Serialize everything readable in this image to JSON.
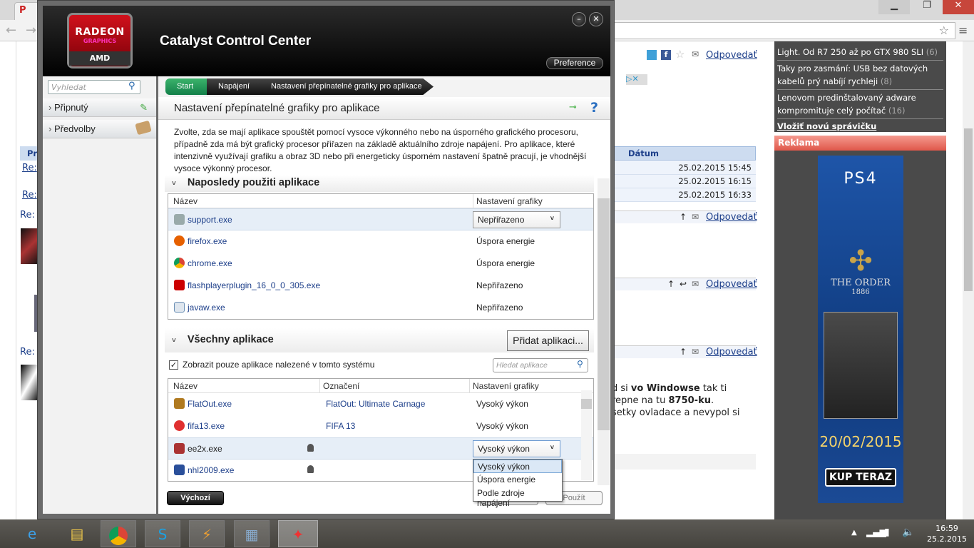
{
  "browser": {
    "tab_title": "Po",
    "win": {
      "min": "▁",
      "restore": "❐",
      "close": "✕"
    }
  },
  "bg_page": {
    "reply": "Odpovedať",
    "re": "Re:",
    "re_short": "Re: ",
    "pr": "Pr",
    "date_header": "Dátum",
    "dates": [
      "25.02.2015 15:45",
      "25.02.2015 16:15",
      "25.02.2015 16:33"
    ],
    "post_text": [
      [
        "d si ",
        "vo Windowse",
        " tak ti"
      ],
      [
        "repne na tu ",
        "8750-ku",
        "."
      ],
      [
        "setky ovladace a nevypol si",
        "",
        ""
      ]
    ]
  },
  "sidebar": {
    "news": [
      {
        "title": "Light. Od R7 250 až po GTX 980 SLI",
        "count": "(6)"
      },
      {
        "title": "Taky pro zasmání: USB bez datových kabelů prý nabíjí rychleji",
        "count": "(8)"
      },
      {
        "title": "Lenovom predinštalovaný adware kompromituje celý počítač",
        "count": "(16)"
      }
    ],
    "add_news": "Vložiť novú správičku",
    "ad_header": "Reklama",
    "ad": {
      "brand": "PS4",
      "game": "THE ORDER",
      "year": "1886",
      "date": "20/02/2015",
      "cta": "KUP TERAZ"
    }
  },
  "ccc": {
    "logo": {
      "line1": "RADEON",
      "line2": "GRAPHICS",
      "line3": "AMD"
    },
    "title": "Catalyst Control Center",
    "preference": "Preference",
    "search_placeholder": "Vyhledat",
    "nav": [
      "Připnutý",
      "Předvolby"
    ],
    "breadcrumb": [
      "Start",
      "Napájení",
      "Nastavení přepínatelné grafiky pro aplikace"
    ],
    "page_title": "Nastavení přepínatelné grafiky pro aplikace",
    "help": "?",
    "description": "Zvolte, zda se mají aplikace spouštět pomocí vysoce výkonného nebo na úsporného grafického procesoru, případně zda má být grafický procesor přiřazen na základě aktuálního zdroje napájení. Pro aplikace, které intenzivně využívají grafiku a obraz 3D nebo při energeticky úsporném nastavení špatně pracují, je vhodnější vysoce výkonný procesor.",
    "recent": {
      "title": "Naposledy použiti aplikace",
      "col_name": "Název",
      "col_setting": "Nastavení grafiky",
      "rows": [
        {
          "name": "support.exe",
          "setting": "Nepřiřazeno",
          "color": "#9aa"
        },
        {
          "name": "firefox.exe",
          "setting": "Úspora energie",
          "color": "#e66000"
        },
        {
          "name": "chrome.exe",
          "setting": "Úspora energie",
          "color": "#3b9a3b"
        },
        {
          "name": "flashplayerplugin_16_0_0_305.exe",
          "setting": "Nepřiřazeno",
          "color": "#c00"
        },
        {
          "name": "javaw.exe",
          "setting": "Nepřiřazeno",
          "color": "#6a8fb5"
        }
      ]
    },
    "all": {
      "title": "Všechny aplikace",
      "add_button": "Přidat aplikaci...",
      "only_found": "Zobrazit pouze aplikace nalezené v tomto systému",
      "filter_placeholder": "Hledat aplikace",
      "col_name": "Název",
      "col_label": "Označení",
      "col_setting": "Nastavení grafiky",
      "rows": [
        {
          "name": "FlatOut.exe",
          "label": "FlatOut: Ultimate Carnage",
          "setting": "Vysoký výkon",
          "color": "#b07a20"
        },
        {
          "name": "fifa13.exe",
          "label": "FIFA 13",
          "setting": "Vysoký výkon",
          "color": "#e03030"
        },
        {
          "name": "ee2x.exe",
          "label": "",
          "setting": "Vysoký výkon",
          "color": "#a33"
        },
        {
          "name": "nhl2009.exe",
          "label": "",
          "setting": "",
          "color": "#2a4f9a"
        }
      ],
      "options": [
        "Vysoký výkon",
        "Úspora energie",
        "Podle zdroje napájení"
      ]
    },
    "default_button": "Výchozí",
    "apply_button": "Použít"
  },
  "tray": {
    "time": "16:59",
    "date": "25.2.2015"
  }
}
